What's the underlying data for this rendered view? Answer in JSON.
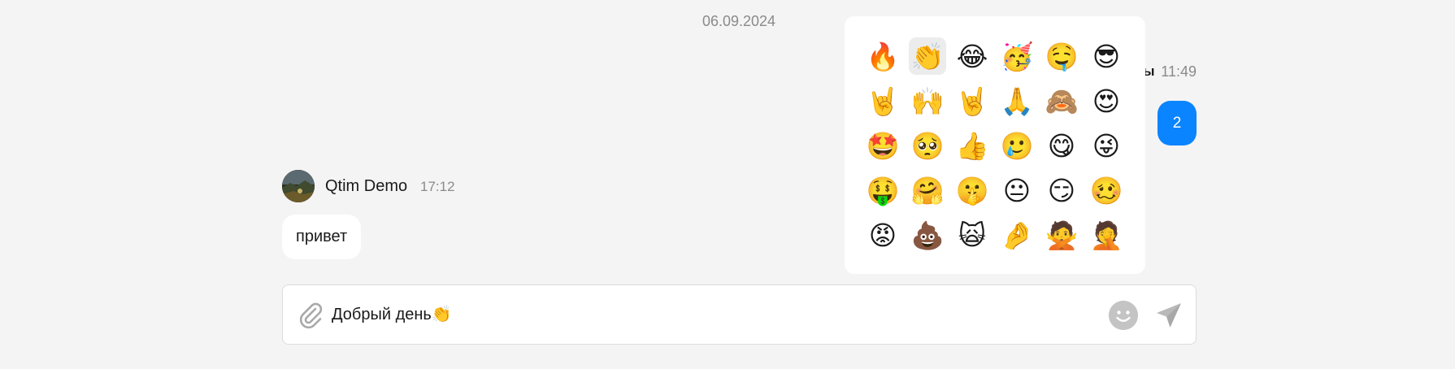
{
  "chat": {
    "date_separator": "06.09.2024",
    "own_message": {
      "author_tail": "ы",
      "time": "11:49",
      "text": "2"
    },
    "incoming_message": {
      "author": "Qtim Demo",
      "time": "17:12",
      "text": "привет",
      "avatar_icon": "avatar-photo"
    }
  },
  "emoji_picker": {
    "selected_index": 1,
    "emojis": [
      "🔥",
      "👏",
      "😂",
      "🥳",
      "🤤",
      "😎",
      "🤘",
      "🙌",
      "🤘",
      "🙏",
      "🙈",
      "😍",
      "🤩",
      "🥺",
      "👍",
      "🥲",
      "😋",
      "😜",
      "🤑",
      "🤗",
      "🤫",
      "😐",
      "😏",
      "🥴",
      "😡",
      "💩",
      "🙀",
      "🤌",
      "🙅",
      "🤦"
    ]
  },
  "composer": {
    "value": "Добрый день👏",
    "attach_icon": "paperclip-icon",
    "emoji_icon": "smiley-icon",
    "send_icon": "paper-plane-icon"
  },
  "colors": {
    "background": "#f4f4f4",
    "own_bubble": "#0a84ff",
    "incoming_bubble": "#ffffff",
    "muted_text": "#8a8a8a",
    "icon_gray": "#c4c4c4"
  }
}
